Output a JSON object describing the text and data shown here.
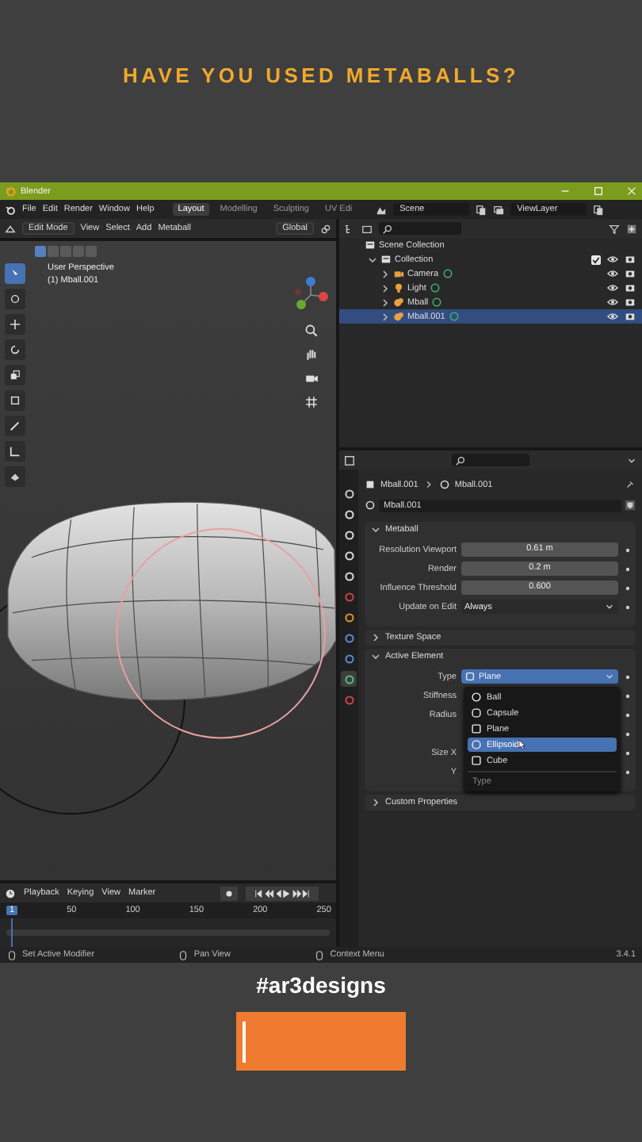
{
  "headline": "HAVE YOU USED METABALLS?",
  "window": {
    "title": "Blender"
  },
  "menu": [
    "File",
    "Edit",
    "Render",
    "Window",
    "Help"
  ],
  "workspace_tabs": [
    {
      "label": "Layout",
      "selected": true
    },
    {
      "label": "Modelling",
      "selected": false
    },
    {
      "label": "Sculpting",
      "selected": false
    },
    {
      "label": "UV Edi",
      "selected": false
    }
  ],
  "scene": "Scene",
  "view_layer": "ViewLayer",
  "viewport": {
    "mode": "Edit Mode",
    "menus": [
      "View",
      "Select",
      "Add",
      "Metaball"
    ],
    "orientation": "Global",
    "perspective": "User Perspective",
    "object": "(1) Mball.001"
  },
  "outliner": {
    "root": "Scene Collection",
    "collections": [
      {
        "label": "Collection",
        "expanded": true,
        "checked": true,
        "children": [
          {
            "label": "Camera",
            "kind": "camera",
            "expanded": false,
            "selected": false
          },
          {
            "label": "Light",
            "kind": "light",
            "expanded": false,
            "selected": false
          },
          {
            "label": "Mball",
            "kind": "mball",
            "expanded": false,
            "selected": false
          },
          {
            "label": "Mball.001",
            "kind": "mball",
            "expanded": false,
            "selected": true
          }
        ]
      }
    ]
  },
  "properties": {
    "tabs": [
      {
        "selected": false
      },
      {
        "selected": false
      },
      {
        "selected": false
      },
      {
        "selected": false
      },
      {
        "selected": false
      },
      {
        "selected": false
      },
      {
        "selected": false
      },
      {
        "selected": false
      },
      {
        "selected": false
      },
      {
        "selected": true
      },
      {
        "selected": false
      }
    ],
    "breadcrumb": [
      "Mball.001",
      "Mball.001"
    ],
    "datablock": "Mball.001",
    "panels": [
      {
        "title": "Metaball",
        "expanded": true,
        "fields": [
          {
            "label": "Resolution Viewport",
            "value": "0.61 m",
            "kind": "number"
          },
          {
            "label": "Render",
            "value": "0.2 m",
            "kind": "number"
          },
          {
            "label": "Influence Threshold",
            "value": "0.600",
            "kind": "number"
          },
          {
            "label": "Update on Edit",
            "value": "Always",
            "kind": "dropdown"
          }
        ]
      },
      {
        "title": "Texture Space",
        "expanded": false
      },
      {
        "title": "Active Element",
        "expanded": true,
        "fields": [
          {
            "label": "Type",
            "value": "Plane",
            "kind": "dropdown"
          },
          {
            "label": "Stiffness",
            "kind": "covered"
          },
          {
            "label": "Radius",
            "kind": "covered"
          },
          {
            "kind": "covered"
          },
          {
            "label": "Size X",
            "kind": "covered"
          },
          {
            "label": "Y",
            "kind": "covered"
          }
        ],
        "menu": {
          "title": "Type",
          "items": [
            {
              "label": "Ball",
              "selected": false
            },
            {
              "label": "Capsule",
              "selected": false
            },
            {
              "label": "Plane",
              "selected": false
            },
            {
              "label": "Ellipsoid",
              "selected": true
            },
            {
              "label": "Cube",
              "selected": false
            }
          ]
        }
      },
      {
        "title": "Custom Properties",
        "expanded": false
      }
    ]
  },
  "timeline": {
    "menus": [
      "Playback",
      "Keying",
      "View",
      "Marker"
    ],
    "current_frame": "1",
    "ticks": [
      "50",
      "100",
      "150",
      "200",
      "250"
    ]
  },
  "status_bar": {
    "hints": [
      "Set Active Modifier",
      "Pan View",
      "Context Menu"
    ],
    "version": "3.4.1"
  },
  "hashtag": "#ar3designs"
}
